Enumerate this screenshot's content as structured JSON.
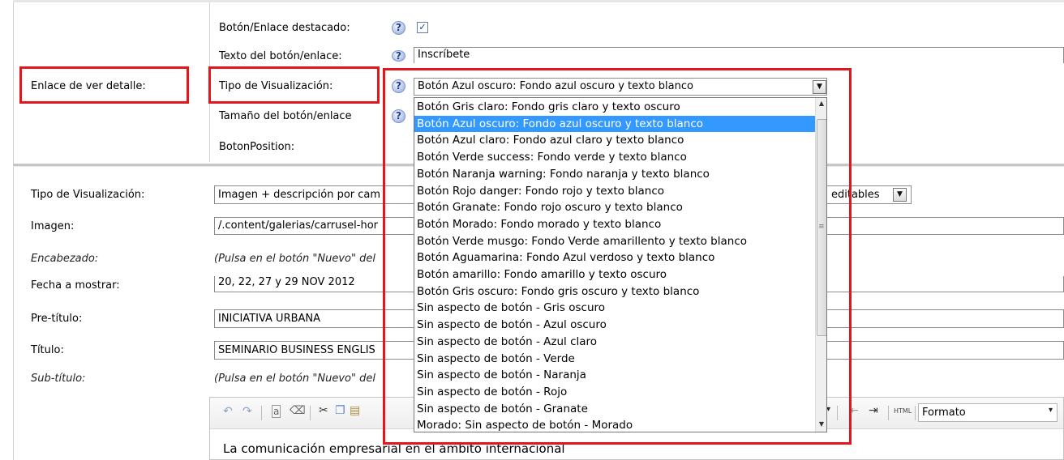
{
  "top_section": {
    "row_label": "Enlace de ver detalle:",
    "highlighted_label": "Botón/Enlace destacado:",
    "highlighted_checked": true,
    "button_text_label": "Texto del botón/enlace:",
    "button_text_value": "Inscríbete",
    "display_type_label": "Tipo de Visualización:",
    "display_type_value": "Botón Azul oscuro: Fondo azul oscuro y texto blanco",
    "button_size_label": "Tamaño del botón/enlace",
    "button_position_label": "BotonPosition:"
  },
  "dropdown": {
    "options": [
      "Botón Gris claro: Fondo gris claro y texto oscuro",
      "Botón Azul oscuro: Fondo azul oscuro y texto blanco",
      "Botón Azul claro: Fondo azul claro y texto blanco",
      "Botón Verde success: Fondo verde y texto blanco",
      "Botón Naranja warning: Fondo naranja y texto blanco",
      "Botón Rojo danger: Fondo rojo y texto blanco",
      "Botón Granate: Fondo rojo oscuro y texto blanco",
      "Botón Morado: Fondo morado y texto blanco",
      "Botón Verde musgo: Fondo Verde amarillento y texto blanco",
      "Botón Aguamarina: Fondo Azul verdoso y texto blanco",
      "Botón amarillo: Fondo amarillo y texto oscuro",
      "Botón Gris oscuro: Fondo gris oscuro y texto blanco",
      "Sin aspecto de botón - Gris oscuro",
      "Sin aspecto de botón - Azul oscuro",
      "Sin aspecto de botón - Azul claro",
      "Sin aspecto de botón - Verde",
      "Sin aspecto de botón - Naranja",
      "Sin aspecto de botón - Rojo",
      "Sin aspecto de botón - Granate",
      "Morado: Sin aspecto de botón - Morado"
    ],
    "selected_index": 1
  },
  "main_section": {
    "display_type_label": "Tipo de Visualización:",
    "display_type_value": "Imagen + descripción por campos editables",
    "display_type_visible_start": "Imagen + descripción por cam",
    "display_type_visible_end": "editables",
    "image_label": "Imagen:",
    "image_value": "/.content/galerias/carrusel-hor",
    "heading_label": "Encabezado:",
    "heading_hint": "(Pulsa en el botón \"Nuevo\" del",
    "date_label": "Fecha a mostrar:",
    "date_value": "20, 22, 27 y 29 NOV 2012",
    "pretitle_label": "Pre-título:",
    "pretitle_value": "INICIATIVA URBANA",
    "title_label": "Título:",
    "title_value": "SEMINARIO BUSINESS ENGLIS",
    "subtitle_label": "Sub-título:",
    "subtitle_hint": "(Pulsa en el botón \"Nuevo\" del",
    "editor_format_label": "Formato",
    "editor_html_label": "HTML",
    "editor_content": "La comunicación empresarial en el ámbito internacional"
  },
  "colors": {
    "highlight_red": "#e3161b",
    "selection_blue": "#3399ff"
  }
}
